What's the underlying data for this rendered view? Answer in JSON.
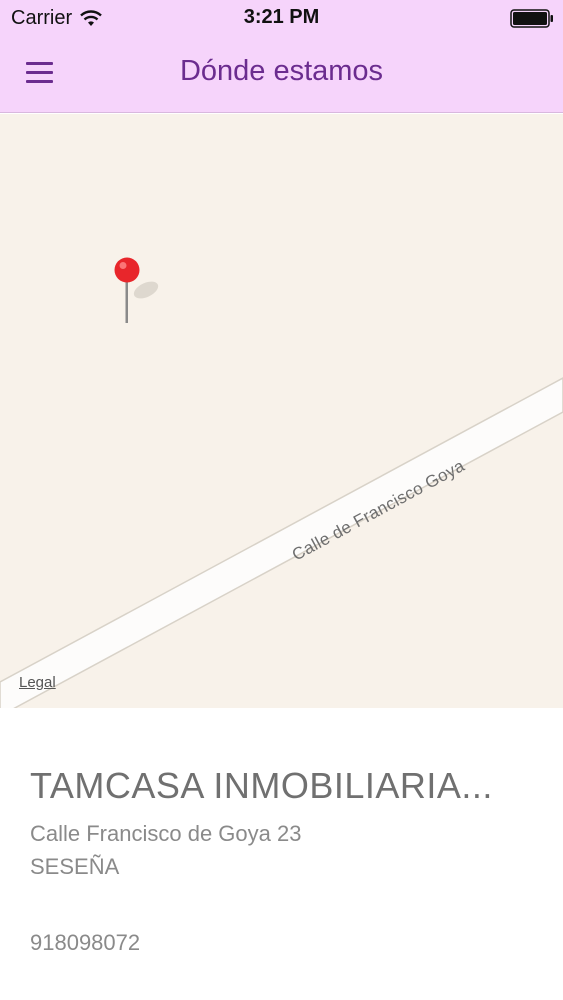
{
  "status_bar": {
    "carrier": "Carrier",
    "time": "3:21 PM",
    "icons": [
      "wifi-icon",
      "battery-icon"
    ]
  },
  "nav": {
    "title": "Dónde estamos",
    "menu_icon": "hamburger-menu-icon",
    "background": "#f6d4fb",
    "accent": "#6b2c8f"
  },
  "map": {
    "street_name": "Calle de Francisco Goya",
    "legal_label": "Legal",
    "pin_icon": "map-pin-icon",
    "pin_color": "#e8262b"
  },
  "place": {
    "name": "TAMCASA  INMOBILIARIA...",
    "address": "Calle Francisco de Goya 23",
    "city": "SESEÑA",
    "phone": "918098072"
  }
}
